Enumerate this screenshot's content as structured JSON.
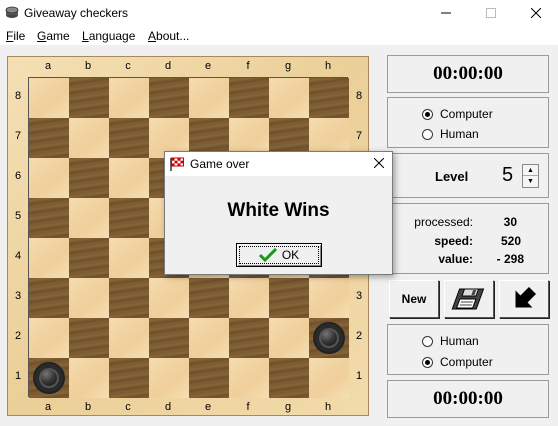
{
  "window": {
    "title": "Giveaway checkers"
  },
  "menu": {
    "items": [
      {
        "accel": "F",
        "rest": "ile"
      },
      {
        "accel": "G",
        "rest": "ame"
      },
      {
        "accel": "L",
        "rest": "anguage"
      },
      {
        "accel": "A",
        "rest": "bout..."
      }
    ]
  },
  "board": {
    "files": [
      "a",
      "b",
      "c",
      "d",
      "e",
      "f",
      "g",
      "h"
    ],
    "ranks": [
      "8",
      "7",
      "6",
      "5",
      "4",
      "3",
      "2",
      "1"
    ],
    "pieces": [
      {
        "square": "a1",
        "color": "black"
      },
      {
        "square": "h2",
        "color": "black"
      }
    ]
  },
  "top_player": {
    "timer": "00:00:00",
    "options": [
      "Computer",
      "Human"
    ],
    "selected": "Computer"
  },
  "level": {
    "label": "Level",
    "value": "5"
  },
  "stats": {
    "processed_label": "processed:",
    "processed_value": "30",
    "speed_label": "speed:",
    "speed_value": "520",
    "value_label": "value:",
    "value_value": "- 298"
  },
  "toolbar": {
    "new_label": "New"
  },
  "bottom_player": {
    "timer": "00:00:00",
    "options": [
      "Human",
      "Computer"
    ],
    "selected": "Computer"
  },
  "dialog": {
    "title": "Game over",
    "message": "White Wins",
    "ok_label": "OK"
  }
}
